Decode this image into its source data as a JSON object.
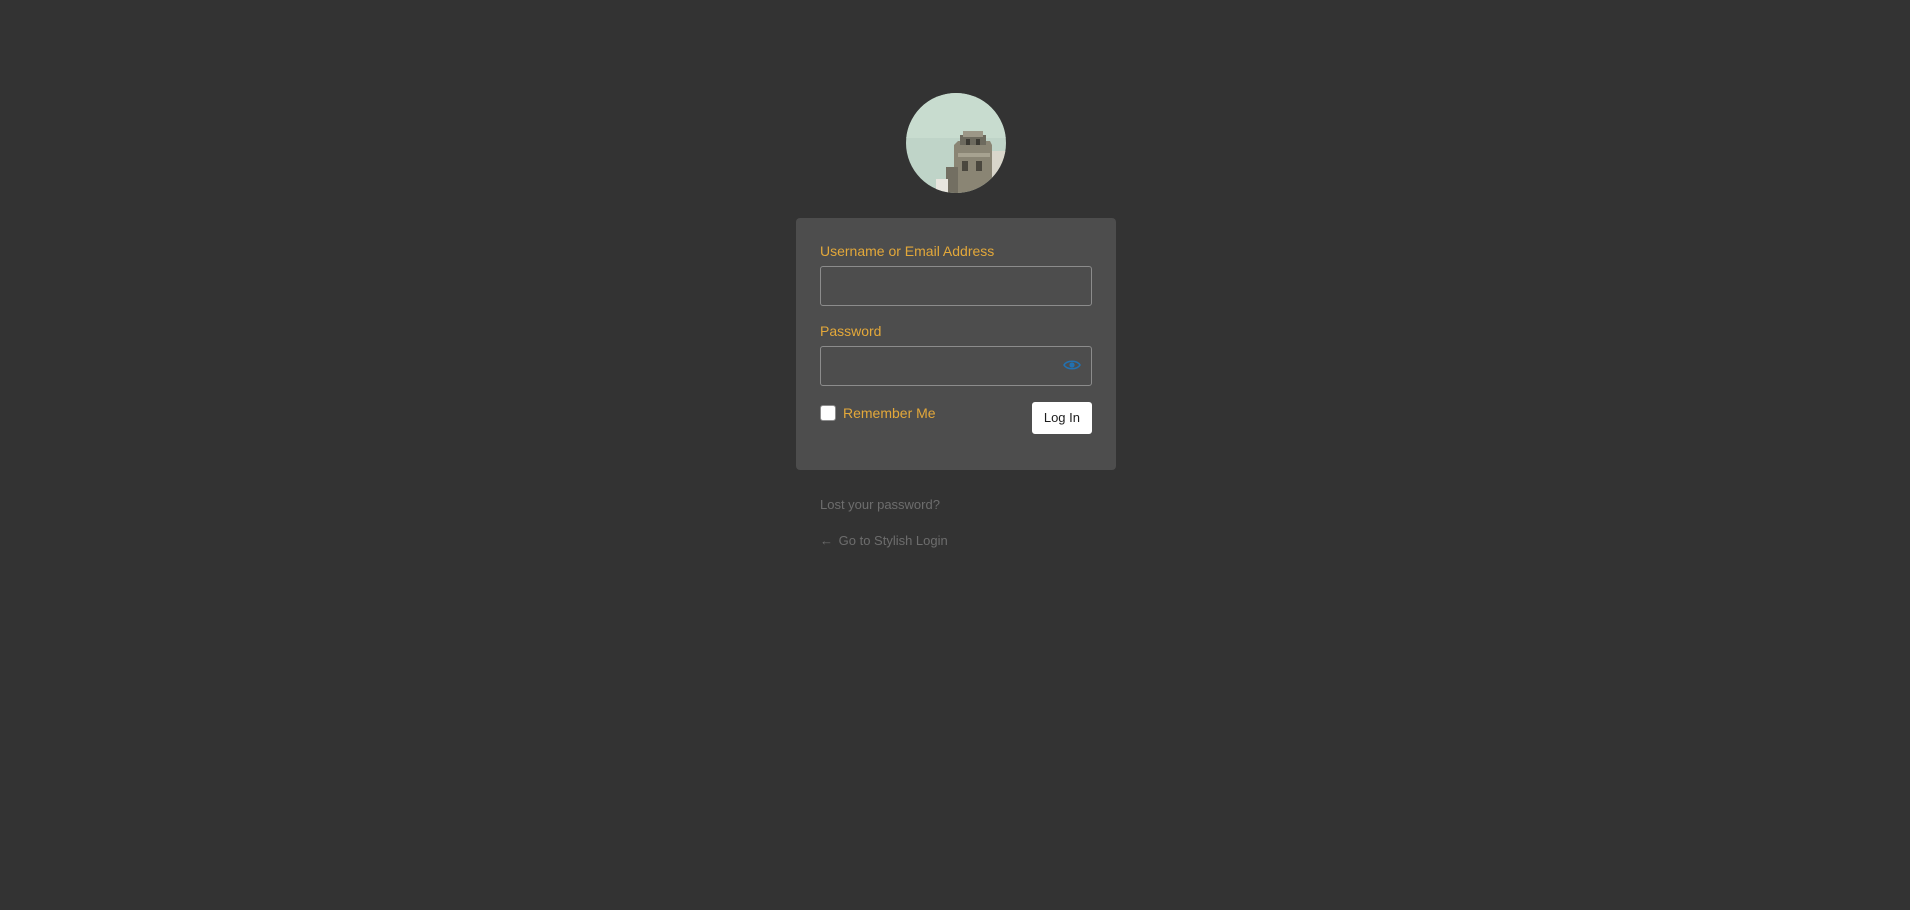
{
  "logo": {
    "icon": "site-logo-building-photo"
  },
  "form": {
    "username_label": "Username or Email Address",
    "username_value": "",
    "password_label": "Password",
    "password_value": "",
    "show_password_icon": "eye-icon",
    "remember_label": "Remember Me",
    "remember_checked": false,
    "submit_label": "Log In"
  },
  "links": {
    "lost_password": "Lost your password?",
    "back_arrow": "←",
    "back_to_site": "Go to Stylish Login"
  },
  "colors": {
    "page_background": "#333333",
    "box_background": "#4d4d4d",
    "label_accent": "#e3a83a",
    "eye_icon": "#2271b1",
    "muted_link": "#6d6d6d"
  }
}
